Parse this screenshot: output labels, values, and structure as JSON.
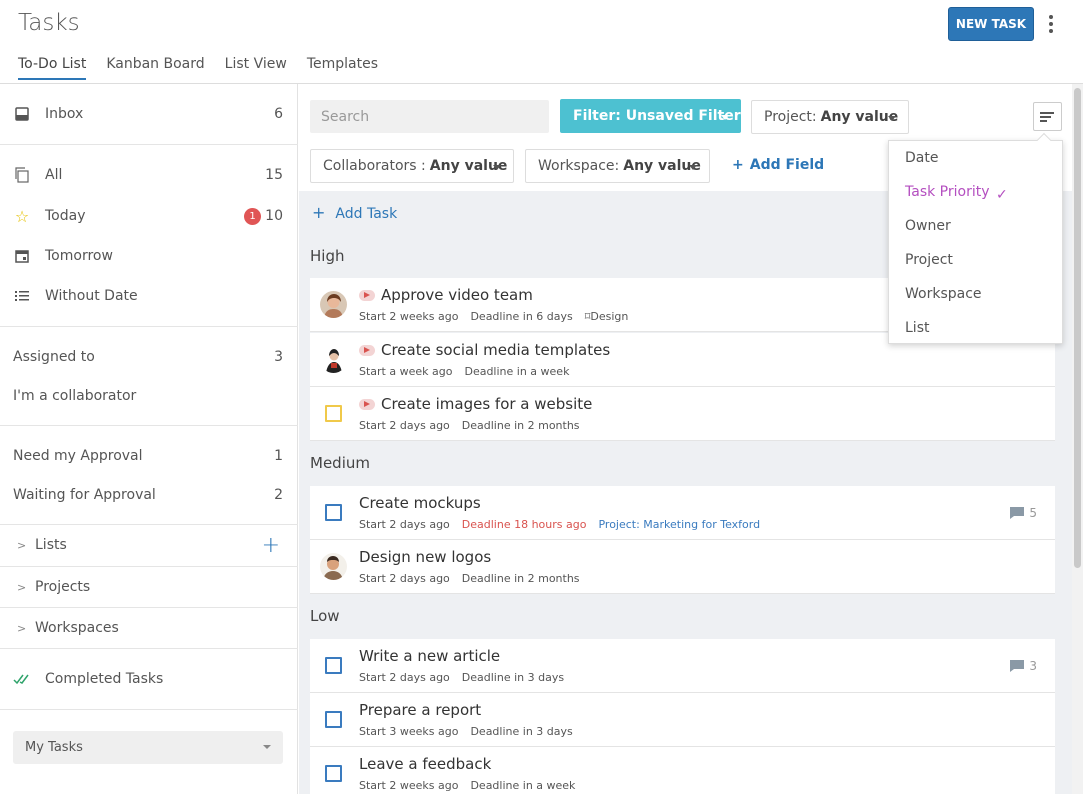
{
  "header": {
    "title": "Tasks",
    "new_task_label": "NEW TASK",
    "tabs": [
      {
        "label": "To-Do List"
      },
      {
        "label": "Kanban Board"
      },
      {
        "label": "List View"
      },
      {
        "label": "Templates"
      }
    ]
  },
  "sidebar": {
    "inbox": {
      "label": "Inbox",
      "count": "6"
    },
    "all": {
      "label": "All",
      "count": "15"
    },
    "today": {
      "label": "Today",
      "badge": "1",
      "count": "10"
    },
    "tomorrow": {
      "label": "Tomorrow"
    },
    "without_date": {
      "label": "Without Date"
    },
    "assigned": {
      "label": "Assigned to",
      "count": "3"
    },
    "collaborator": {
      "label": "I'm a collaborator"
    },
    "need_approval": {
      "label": "Need my Approval",
      "count": "1"
    },
    "waiting_approval": {
      "label": "Waiting for Approval",
      "count": "2"
    },
    "lists": {
      "label": "Lists"
    },
    "projects": {
      "label": "Projects"
    },
    "workspaces": {
      "label": "Workspaces"
    },
    "completed": {
      "label": "Completed Tasks"
    },
    "mytasks_select": "My Tasks"
  },
  "filters": {
    "search_placeholder": "Search",
    "filter_label": "Filter: Unsaved Filter",
    "project_label": "Project:",
    "project_value": "Any value",
    "collab_label": "Collaborators :",
    "collab_value": "Any value",
    "workspace_label": "Workspace:",
    "workspace_value": "Any value",
    "add_field": "Add Field"
  },
  "add_task": "Add Task",
  "groups": {
    "high": "High",
    "medium": "Medium",
    "low": "Low"
  },
  "tasks": {
    "t1": {
      "title": "Approve video team",
      "start": "Start 2 weeks ago",
      "deadline": "Deadline in 6 days",
      "tag": "Design"
    },
    "t2": {
      "title": "Create social media templates",
      "start": "Start a week ago",
      "deadline": "Deadline in a week"
    },
    "t3": {
      "title": "Create images for a website",
      "start": "Start 2 days ago",
      "deadline": "Deadline in 2 months"
    },
    "t4": {
      "title": "Create mockups",
      "start": "Start 2 days ago",
      "deadline": "Deadline 18 hours ago",
      "project": "Project: Marketing for Texford",
      "comments": "5"
    },
    "t5": {
      "title": "Design new logos",
      "start": "Start 2 days ago",
      "deadline": "Deadline in 2 months"
    },
    "t6": {
      "title": "Write a new article",
      "start": "Start 2 days ago",
      "deadline": "Deadline in 3 days",
      "comments": "3"
    },
    "t7": {
      "title": "Prepare a report",
      "start": "Start 3 weeks ago",
      "deadline": "Deadline in 3 days"
    },
    "t8": {
      "title": "Leave a feedback",
      "start": "Start 2 weeks ago",
      "deadline": "Deadline in a week"
    }
  },
  "sort_menu": {
    "items": [
      {
        "label": "Date"
      },
      {
        "label": "Task Priority"
      },
      {
        "label": "Owner"
      },
      {
        "label": "Project"
      },
      {
        "label": "Workspace"
      },
      {
        "label": "List"
      }
    ],
    "selected": "Task Priority",
    "check": "✓"
  },
  "colors": {
    "accent": "#2d77b7",
    "filter": "#4dc1d1",
    "selected": "#b44fc0",
    "overdue": "#d9534f"
  }
}
